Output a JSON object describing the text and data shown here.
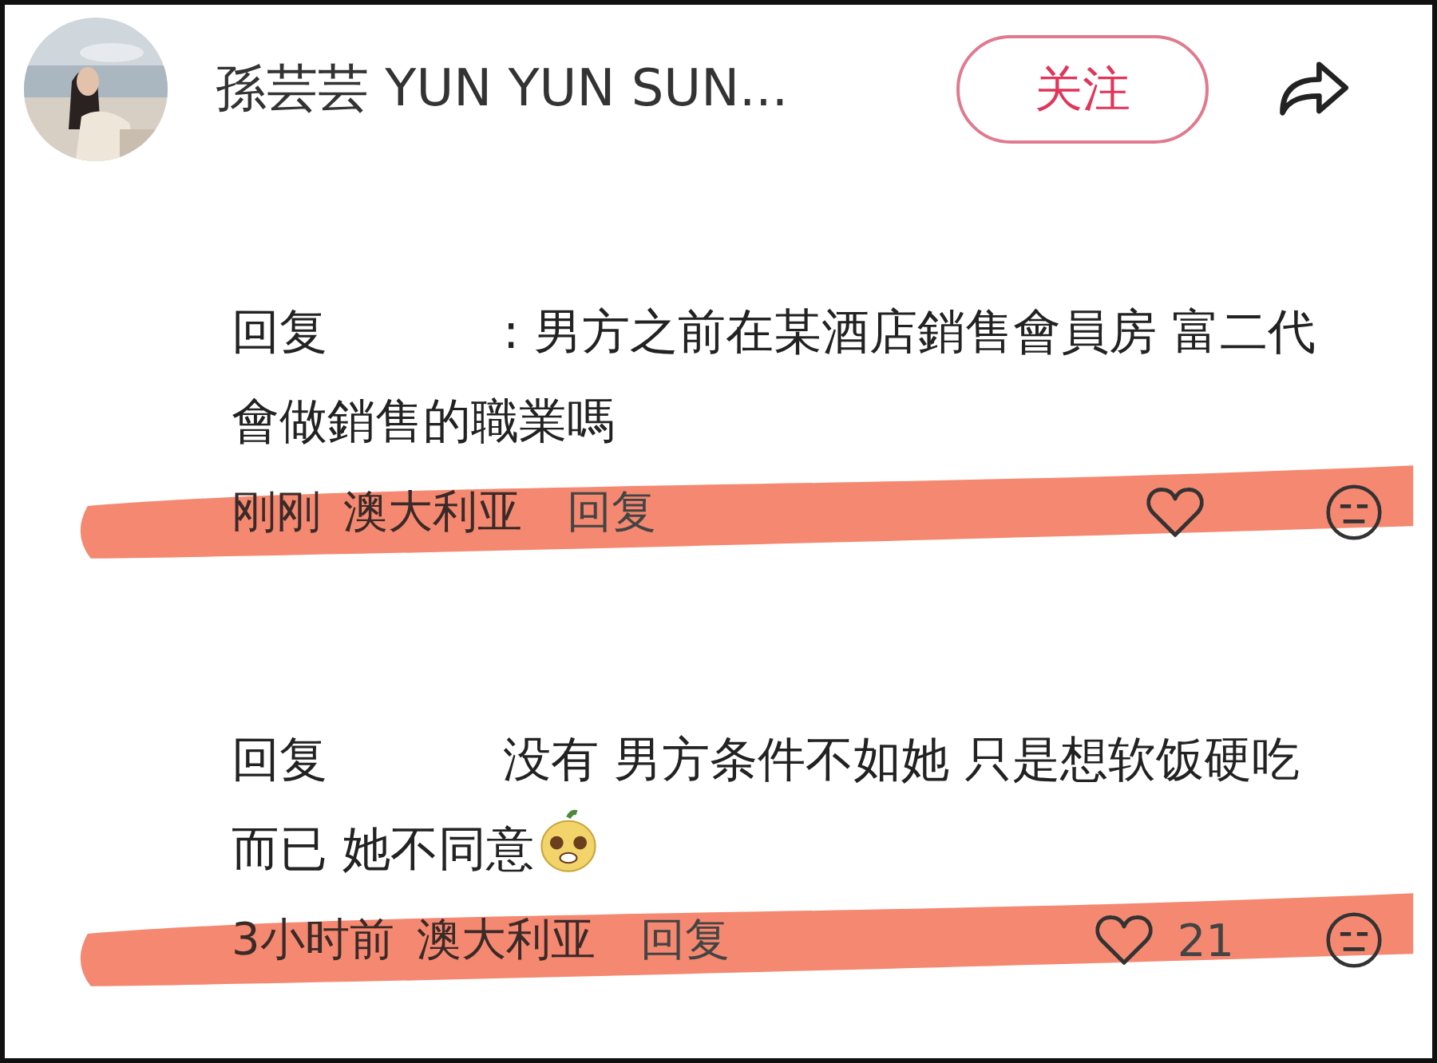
{
  "header": {
    "author": "孫芸芸 YUN YUN SUN...",
    "follow_button": "关注"
  },
  "comments": [
    {
      "reply_label": "回复",
      "text": ": 男方之前在某酒店銷售會員房 富二代會做銷售的職業嗎",
      "sticker": false,
      "time": "刚刚",
      "location": "澳大利亚",
      "reply_button": "回复"
    },
    {
      "reply_label": "回复",
      "text": "没有 男方条件不如她 只是想软饭硬吃而已 她不同意",
      "sticker": true,
      "time": "3小时前",
      "location": "澳大利亚",
      "reply_button": "回复",
      "likes": "21"
    }
  ]
}
